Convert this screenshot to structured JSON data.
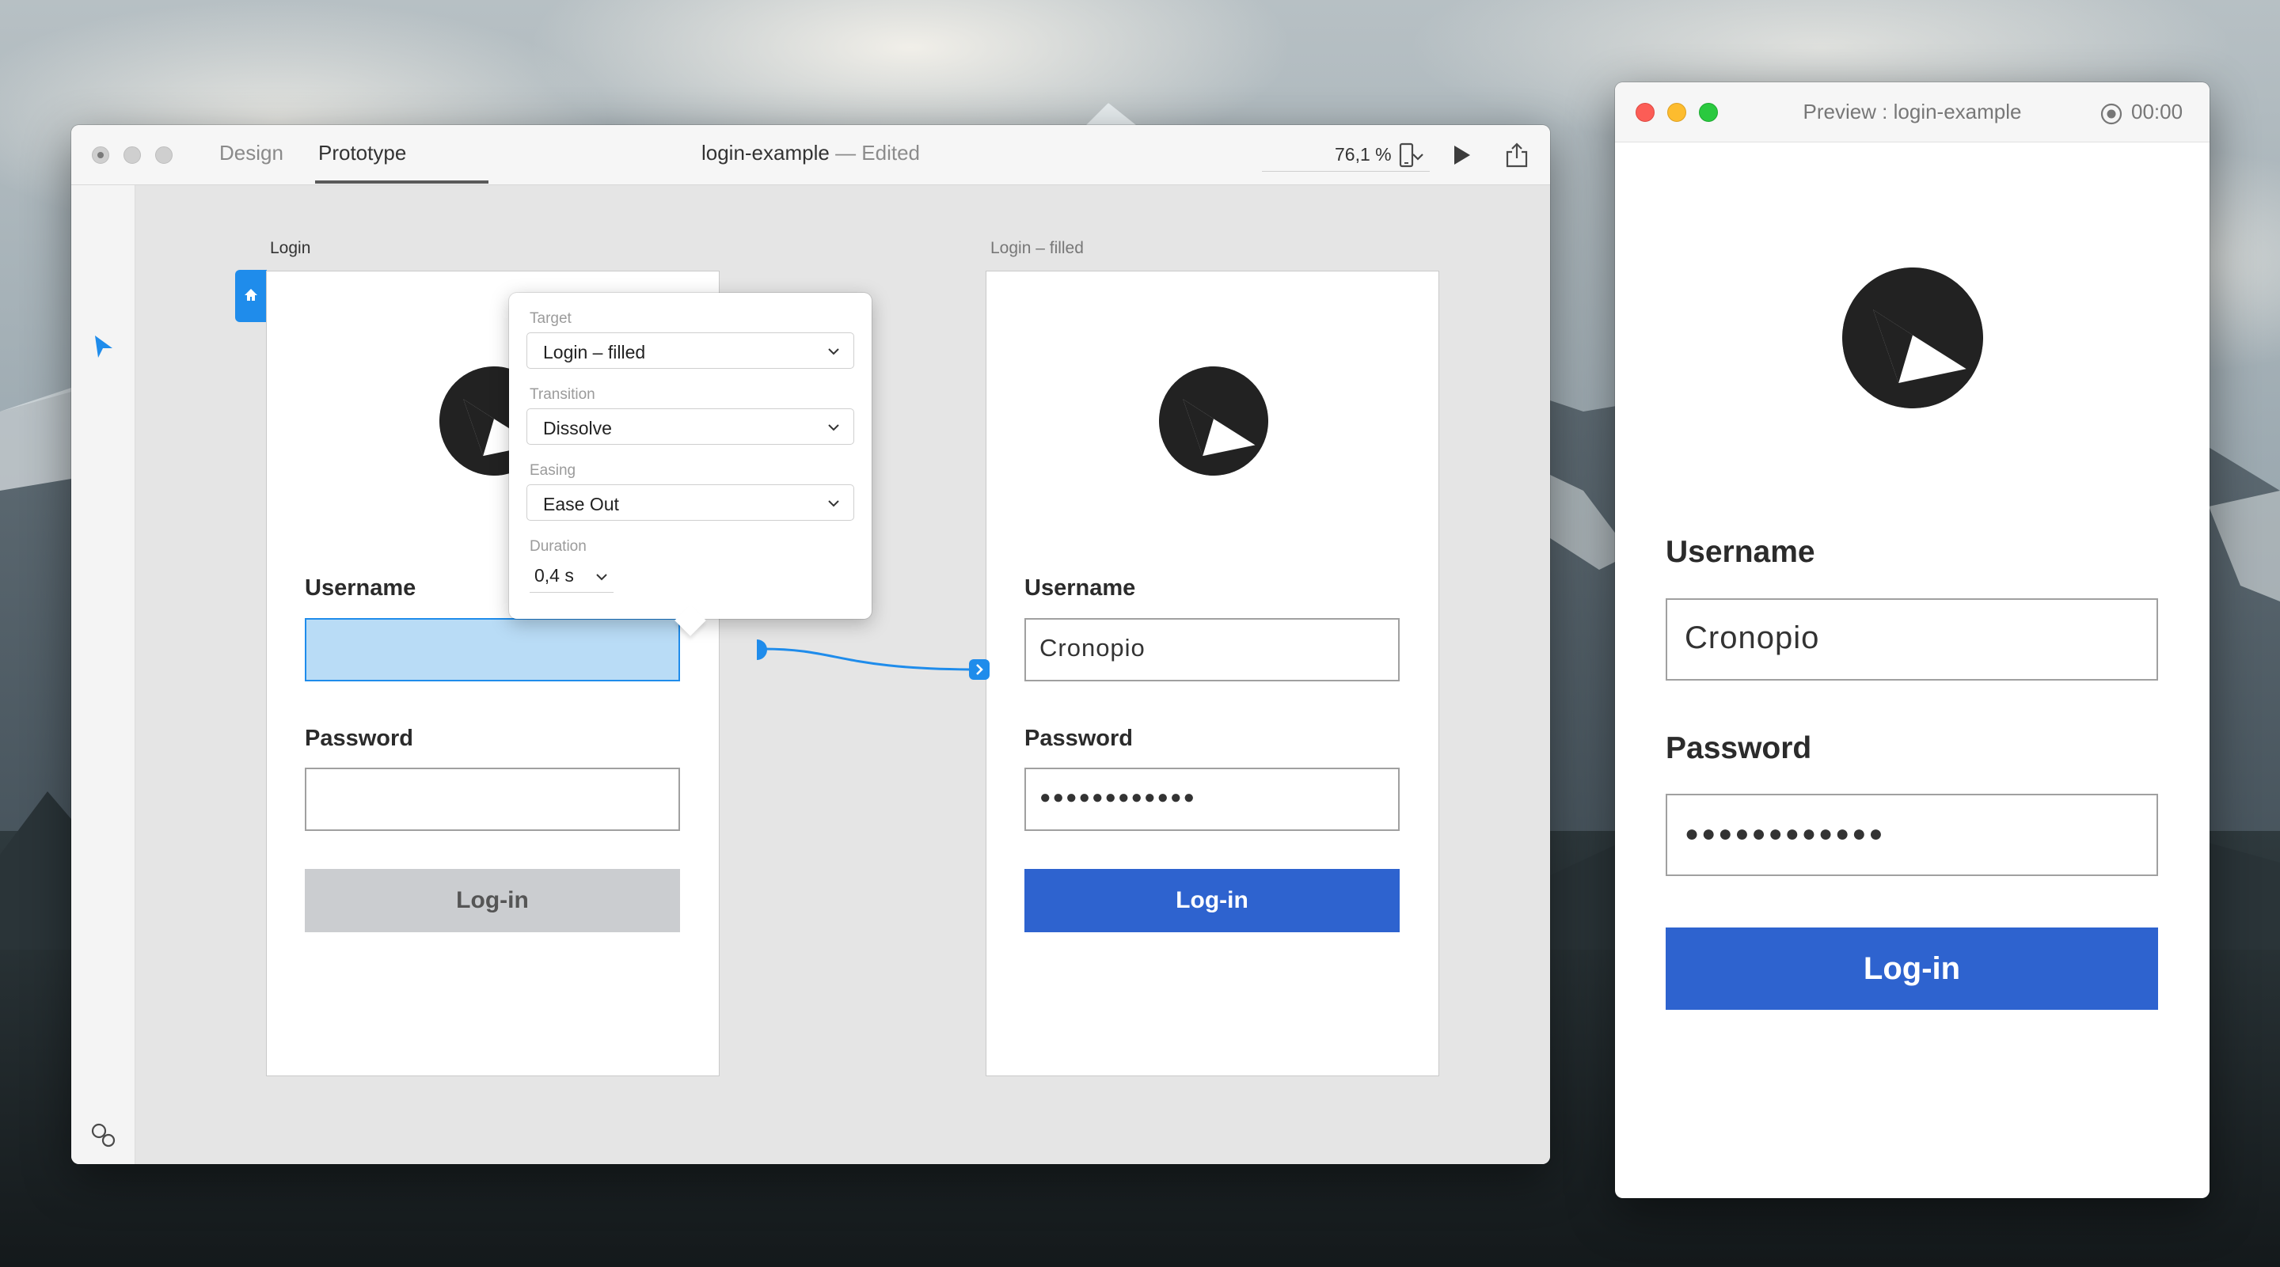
{
  "xd": {
    "mode_tabs": {
      "design": "Design",
      "prototype": "Prototype"
    },
    "doc_name": "login-example",
    "doc_status": " — Edited",
    "zoom": "76,1 %",
    "artboards": {
      "login": {
        "label": "Login",
        "username_label": "Username",
        "password_label": "Password",
        "button_label": "Log-in"
      },
      "login_filled": {
        "label": "Login – filled",
        "username_label": "Username",
        "username_value": "Cronopio",
        "password_label": "Password",
        "password_value": "●●●●●●●●●●●●",
        "button_label": "Log-in"
      }
    },
    "popover": {
      "target_label": "Target",
      "target_value": "Login – filled",
      "transition_label": "Transition",
      "transition_value": "Dissolve",
      "easing_label": "Easing",
      "easing_value": "Ease Out",
      "duration_label": "Duration",
      "duration_value": "0,4 s"
    },
    "icons": {
      "select_tool": "select-arrow-icon",
      "symbols": "symbols-icon",
      "layers": "layers-icon",
      "device": "phone-icon",
      "play": "play-icon",
      "share": "share-icon",
      "home": "home-icon"
    }
  },
  "preview": {
    "title": "Preview : login-example",
    "timer": "00:00",
    "username_label": "Username",
    "username_value": "Cronopio",
    "password_label": "Password",
    "password_value": "●●●●●●●●●●●●",
    "button_label": "Log-in"
  },
  "colors": {
    "accent_blue": "#1f8ceb",
    "primary_button": "#2e63cf",
    "disabled_button": "#cbcdd0",
    "selected_fill": "#b9dcf6",
    "traffic_red": "#fc5d56",
    "traffic_yellow": "#fdbc2e",
    "traffic_green": "#2ac93f"
  }
}
